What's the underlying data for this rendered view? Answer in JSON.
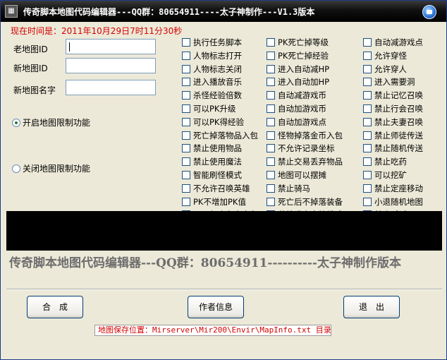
{
  "window": {
    "title": "传奇脚本地图代码编辑器---QQ群：80654911----太子神制作---V1.3版本"
  },
  "time": {
    "label": "现在时间是：2011年10月29日7时11分30秒"
  },
  "fields": {
    "old_map_id_label": "老地图ID",
    "new_map_id_label": "新地图ID",
    "new_map_name_label": "新地图名字",
    "old_map_id_value": "",
    "new_map_id_value": "",
    "new_map_name_value": ""
  },
  "limit": {
    "enable_label": "开启地图限制功能",
    "disable_label": "关闭地图限制功能",
    "selected": "enable"
  },
  "options": {
    "col1": [
      "执行任务脚本",
      "人物标志打开",
      "人物标志关闭",
      "进入播放音乐",
      "杀怪经验倍数",
      "可以PK升级",
      "可以PK得经验",
      "死亡掉落物品入包",
      "禁止使用物品",
      "禁止使用魔法",
      "智能刷怪模式",
      "不允许召唤英雄",
      "PK不增加PK值",
      "不同行会名字变色"
    ],
    "col2": [
      "PK死亡掉等级",
      "PK死亡掉经验",
      "进入自动减HP",
      "进入自动加HP",
      "自动减游戏币",
      "自动加游戏币",
      "自动加游戏点",
      "怪物掉落金币入包",
      "不允许记录坐标",
      "禁止交易丢弃物品",
      "地图可以摆摊",
      "禁止骑马",
      "死亡后不掉落装备",
      "英雄退出守护模式"
    ],
    "col3": [
      "自动减游戏点",
      "允许穿怪",
      "允许穿人",
      "进入需要洞",
      "禁止记忆召唤",
      "禁止行会召唤",
      "禁止夫妻召唤",
      "禁止师徒传送",
      "禁止随机传送",
      "禁止吃药",
      "可以挖矿",
      "禁止定座移动",
      "小退随机地图",
      "禁止喊话"
    ]
  },
  "banner": {
    "text": "传奇脚本地图代码编辑器---QQ群：80654911----------太子神制作版本"
  },
  "buttons": {
    "compose": "合　成",
    "author_info": "作者信息",
    "exit": "退　出"
  },
  "save_path": {
    "text": "地图保存位置：Mirserver\\Mir200\\Envir\\MapInfo.txt 目录"
  },
  "colors": {
    "accent_red": "#d40000",
    "titlebar": "#000000"
  }
}
